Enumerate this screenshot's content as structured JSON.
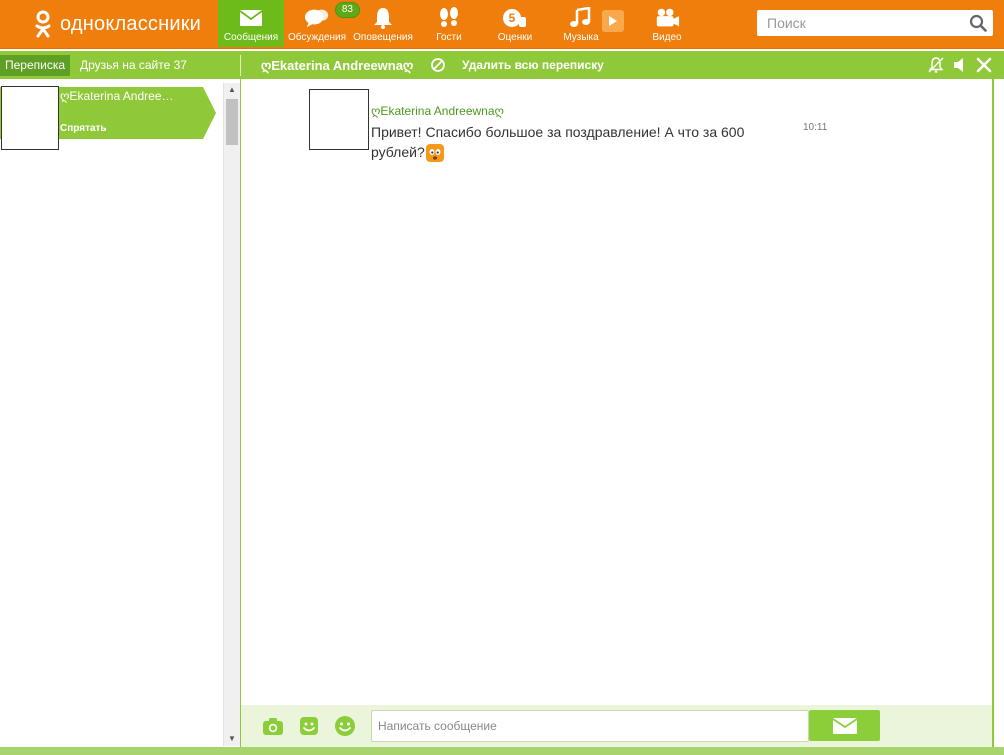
{
  "app": {
    "name": "одноклассники"
  },
  "colors": {
    "brand_orange": "#f07e0c",
    "brand_green": "#8fc93a",
    "active_green": "#6dbb1a"
  },
  "nav": {
    "items": [
      {
        "label": "Сообщения",
        "icon": "envelope-icon",
        "active": true
      },
      {
        "label": "Обсуждения",
        "icon": "chat-bubbles-icon",
        "badge": "83"
      },
      {
        "label": "Оповещения",
        "icon": "bell-icon"
      },
      {
        "label": "Гости",
        "icon": "footprints-icon"
      },
      {
        "label": "Оценки",
        "icon": "rating-five-icon"
      },
      {
        "label": "Музыка",
        "icon": "music-note-icon"
      },
      {
        "label": "Видео",
        "icon": "video-camera-icon"
      }
    ]
  },
  "search": {
    "placeholder": "Поиск"
  },
  "tabs": {
    "correspondence": "Переписка",
    "friends_online": "Друзья на сайте 37"
  },
  "chat": {
    "title": "ღEkaterina Andreewnaღ",
    "delete_all": "Удалить всю переписку"
  },
  "dialogs": [
    {
      "name": "ღEkaterina Andree…",
      "hide_label": "Спрятать"
    }
  ],
  "messages": [
    {
      "author": "ღEkaterina Andreewnaღ",
      "text": "Привет! Спасибо большое за поздравление! А что за 600 рублей?",
      "time": "10:11",
      "emoji": "surprised-face-icon"
    }
  ],
  "compose": {
    "placeholder": "Написать сообщение"
  }
}
